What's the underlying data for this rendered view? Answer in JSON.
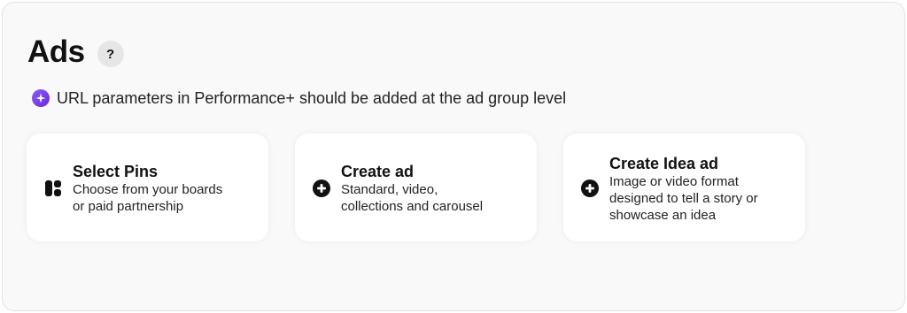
{
  "header": {
    "title": "Ads",
    "help_label": "?"
  },
  "notice": {
    "text": "URL parameters in Performance+ should be added at the ad group level",
    "icon": "sparkle-icon",
    "icon_color": "#7c3aed"
  },
  "cards": [
    {
      "title": "Select Pins",
      "description": "Choose from your boards\nor paid partnership",
      "icon": "pins-grid-icon"
    },
    {
      "title": "Create ad",
      "description": "Standard, video,\ncollections and carousel",
      "icon": "plus-circle-icon"
    },
    {
      "title": "Create Idea ad",
      "description": "Image or video format\ndesigned to tell a story or\nshowcase an idea",
      "icon": "plus-circle-icon"
    }
  ]
}
